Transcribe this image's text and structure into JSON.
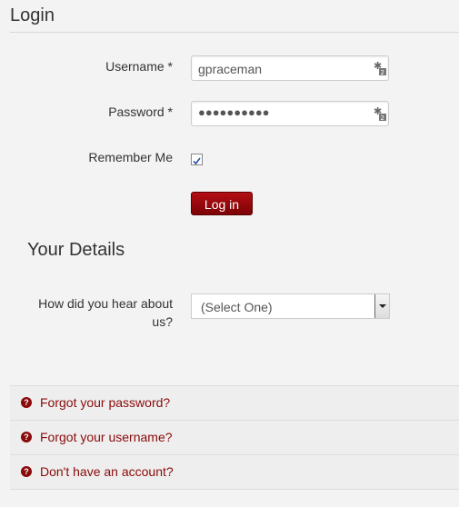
{
  "page": {
    "title": "Login"
  },
  "form": {
    "username_label": "Username *",
    "username_value": "gpraceman",
    "password_label": "Password *",
    "password_dots": "●●●●●●●●●●",
    "remember_label": "Remember Me",
    "remember_checked": true,
    "login_button": "Log in"
  },
  "details": {
    "title": "Your Details",
    "hear_label_line1": "How did you hear about",
    "hear_label_line2": "us?",
    "hear_select_value": "(Select One)"
  },
  "links": [
    {
      "label": "Forgot your password?"
    },
    {
      "label": "Forgot your username?"
    },
    {
      "label": "Don't have an account?"
    }
  ],
  "colors": {
    "accent": "#8a0a0a",
    "button": "#a00a0f",
    "background": "#f3f3f3"
  }
}
